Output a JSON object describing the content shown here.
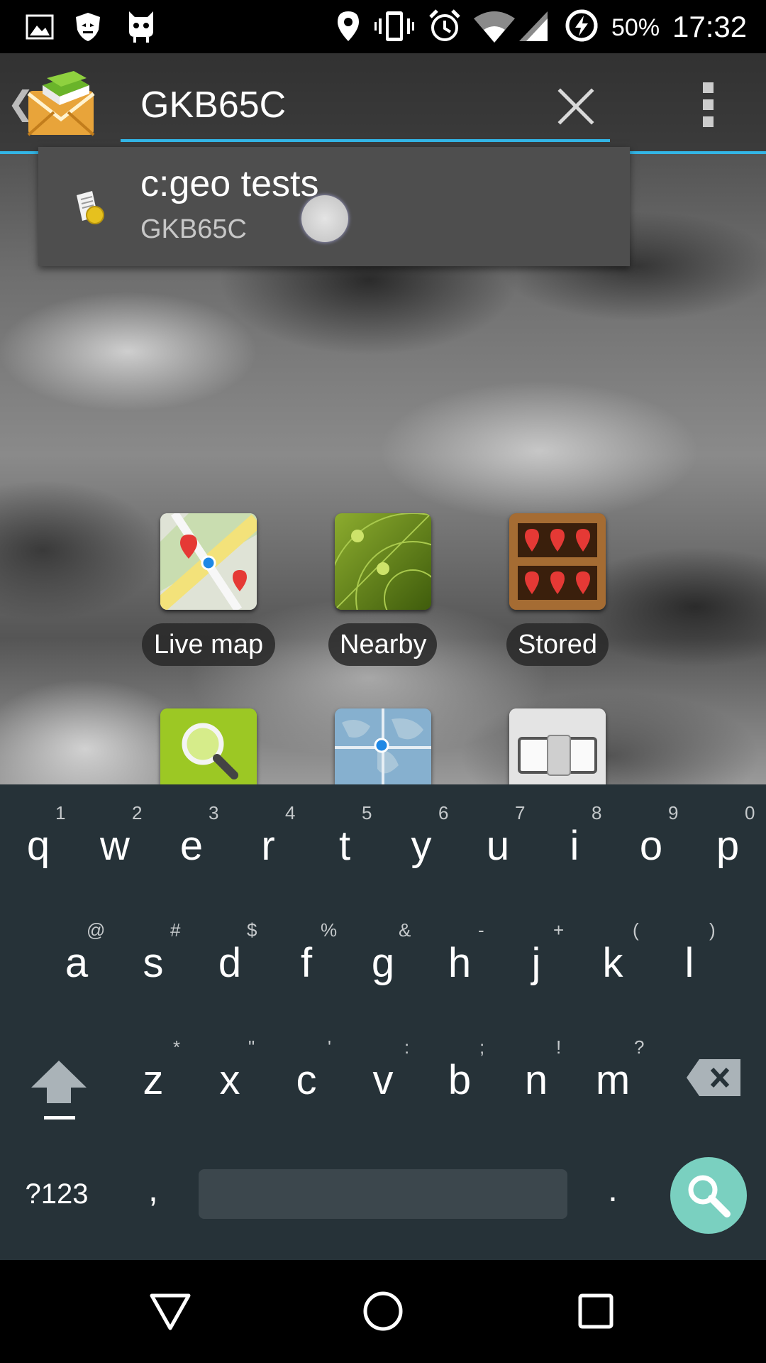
{
  "status_bar": {
    "battery_percent": "50%",
    "time": "17:32"
  },
  "search": {
    "value": "GKB65C"
  },
  "suggestion": {
    "title": "c:geo tests",
    "subtitle": "GKB65C"
  },
  "grid": {
    "live_map": "Live map",
    "nearby": "Nearby",
    "stored": "Stored"
  },
  "keyboard": {
    "row1": [
      {
        "key": "q",
        "hint": "1"
      },
      {
        "key": "w",
        "hint": "2"
      },
      {
        "key": "e",
        "hint": "3"
      },
      {
        "key": "r",
        "hint": "4"
      },
      {
        "key": "t",
        "hint": "5"
      },
      {
        "key": "y",
        "hint": "6"
      },
      {
        "key": "u",
        "hint": "7"
      },
      {
        "key": "i",
        "hint": "8"
      },
      {
        "key": "o",
        "hint": "9"
      },
      {
        "key": "p",
        "hint": "0"
      }
    ],
    "row2": [
      {
        "key": "a",
        "hint": "@"
      },
      {
        "key": "s",
        "hint": "#"
      },
      {
        "key": "d",
        "hint": "$"
      },
      {
        "key": "f",
        "hint": "%"
      },
      {
        "key": "g",
        "hint": "&"
      },
      {
        "key": "h",
        "hint": "-"
      },
      {
        "key": "j",
        "hint": "+"
      },
      {
        "key": "k",
        "hint": "("
      },
      {
        "key": "l",
        "hint": ")"
      }
    ],
    "row3": [
      {
        "key": "z",
        "hint": "*"
      },
      {
        "key": "x",
        "hint": "\""
      },
      {
        "key": "c",
        "hint": "'"
      },
      {
        "key": "v",
        "hint": ":"
      },
      {
        "key": "b",
        "hint": ";"
      },
      {
        "key": "n",
        "hint": "!"
      },
      {
        "key": "m",
        "hint": "?"
      }
    ],
    "symbols_label": "?123",
    "comma": ",",
    "period": "."
  },
  "colors": {
    "accent": "#33b5e5",
    "keyboard_bg": "#263238",
    "search_key": "#7ad0c0"
  },
  "icons": [
    "picture-icon",
    "shield-icon",
    "cyanogen-icon",
    "location-icon",
    "vibrate-icon",
    "alarm-icon",
    "wifi-icon",
    "signal-icon",
    "battery-charging-icon",
    "back-icon",
    "home-icon",
    "recents-icon"
  ]
}
